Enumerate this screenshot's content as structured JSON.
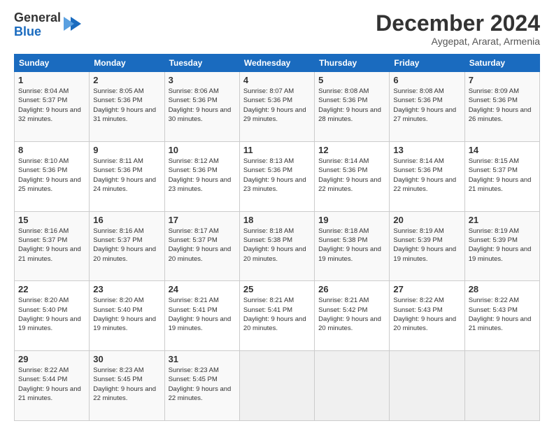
{
  "logo": {
    "general": "General",
    "blue": "Blue"
  },
  "header": {
    "month": "December 2024",
    "location": "Aygepat, Ararat, Armenia"
  },
  "days_of_week": [
    "Sunday",
    "Monday",
    "Tuesday",
    "Wednesday",
    "Thursday",
    "Friday",
    "Saturday"
  ],
  "weeks": [
    [
      {
        "day": "1",
        "sunrise": "8:04 AM",
        "sunset": "5:37 PM",
        "daylight": "9 hours and 32 minutes."
      },
      {
        "day": "2",
        "sunrise": "8:05 AM",
        "sunset": "5:36 PM",
        "daylight": "9 hours and 31 minutes."
      },
      {
        "day": "3",
        "sunrise": "8:06 AM",
        "sunset": "5:36 PM",
        "daylight": "9 hours and 30 minutes."
      },
      {
        "day": "4",
        "sunrise": "8:07 AM",
        "sunset": "5:36 PM",
        "daylight": "9 hours and 29 minutes."
      },
      {
        "day": "5",
        "sunrise": "8:08 AM",
        "sunset": "5:36 PM",
        "daylight": "9 hours and 28 minutes."
      },
      {
        "day": "6",
        "sunrise": "8:08 AM",
        "sunset": "5:36 PM",
        "daylight": "9 hours and 27 minutes."
      },
      {
        "day": "7",
        "sunrise": "8:09 AM",
        "sunset": "5:36 PM",
        "daylight": "9 hours and 26 minutes."
      }
    ],
    [
      {
        "day": "8",
        "sunrise": "8:10 AM",
        "sunset": "5:36 PM",
        "daylight": "9 hours and 25 minutes."
      },
      {
        "day": "9",
        "sunrise": "8:11 AM",
        "sunset": "5:36 PM",
        "daylight": "9 hours and 24 minutes."
      },
      {
        "day": "10",
        "sunrise": "8:12 AM",
        "sunset": "5:36 PM",
        "daylight": "9 hours and 23 minutes."
      },
      {
        "day": "11",
        "sunrise": "8:13 AM",
        "sunset": "5:36 PM",
        "daylight": "9 hours and 23 minutes."
      },
      {
        "day": "12",
        "sunrise": "8:14 AM",
        "sunset": "5:36 PM",
        "daylight": "9 hours and 22 minutes."
      },
      {
        "day": "13",
        "sunrise": "8:14 AM",
        "sunset": "5:36 PM",
        "daylight": "9 hours and 22 minutes."
      },
      {
        "day": "14",
        "sunrise": "8:15 AM",
        "sunset": "5:37 PM",
        "daylight": "9 hours and 21 minutes."
      }
    ],
    [
      {
        "day": "15",
        "sunrise": "8:16 AM",
        "sunset": "5:37 PM",
        "daylight": "9 hours and 21 minutes."
      },
      {
        "day": "16",
        "sunrise": "8:16 AM",
        "sunset": "5:37 PM",
        "daylight": "9 hours and 20 minutes."
      },
      {
        "day": "17",
        "sunrise": "8:17 AM",
        "sunset": "5:37 PM",
        "daylight": "9 hours and 20 minutes."
      },
      {
        "day": "18",
        "sunrise": "8:18 AM",
        "sunset": "5:38 PM",
        "daylight": "9 hours and 20 minutes."
      },
      {
        "day": "19",
        "sunrise": "8:18 AM",
        "sunset": "5:38 PM",
        "daylight": "9 hours and 19 minutes."
      },
      {
        "day": "20",
        "sunrise": "8:19 AM",
        "sunset": "5:39 PM",
        "daylight": "9 hours and 19 minutes."
      },
      {
        "day": "21",
        "sunrise": "8:19 AM",
        "sunset": "5:39 PM",
        "daylight": "9 hours and 19 minutes."
      }
    ],
    [
      {
        "day": "22",
        "sunrise": "8:20 AM",
        "sunset": "5:40 PM",
        "daylight": "9 hours and 19 minutes."
      },
      {
        "day": "23",
        "sunrise": "8:20 AM",
        "sunset": "5:40 PM",
        "daylight": "9 hours and 19 minutes."
      },
      {
        "day": "24",
        "sunrise": "8:21 AM",
        "sunset": "5:41 PM",
        "daylight": "9 hours and 19 minutes."
      },
      {
        "day": "25",
        "sunrise": "8:21 AM",
        "sunset": "5:41 PM",
        "daylight": "9 hours and 20 minutes."
      },
      {
        "day": "26",
        "sunrise": "8:21 AM",
        "sunset": "5:42 PM",
        "daylight": "9 hours and 20 minutes."
      },
      {
        "day": "27",
        "sunrise": "8:22 AM",
        "sunset": "5:43 PM",
        "daylight": "9 hours and 20 minutes."
      },
      {
        "day": "28",
        "sunrise": "8:22 AM",
        "sunset": "5:43 PM",
        "daylight": "9 hours and 21 minutes."
      }
    ],
    [
      {
        "day": "29",
        "sunrise": "8:22 AM",
        "sunset": "5:44 PM",
        "daylight": "9 hours and 21 minutes."
      },
      {
        "day": "30",
        "sunrise": "8:23 AM",
        "sunset": "5:45 PM",
        "daylight": "9 hours and 22 minutes."
      },
      {
        "day": "31",
        "sunrise": "8:23 AM",
        "sunset": "5:45 PM",
        "daylight": "9 hours and 22 minutes."
      },
      null,
      null,
      null,
      null
    ]
  ],
  "labels": {
    "sunrise": "Sunrise:",
    "sunset": "Sunset:",
    "daylight": "Daylight:"
  }
}
